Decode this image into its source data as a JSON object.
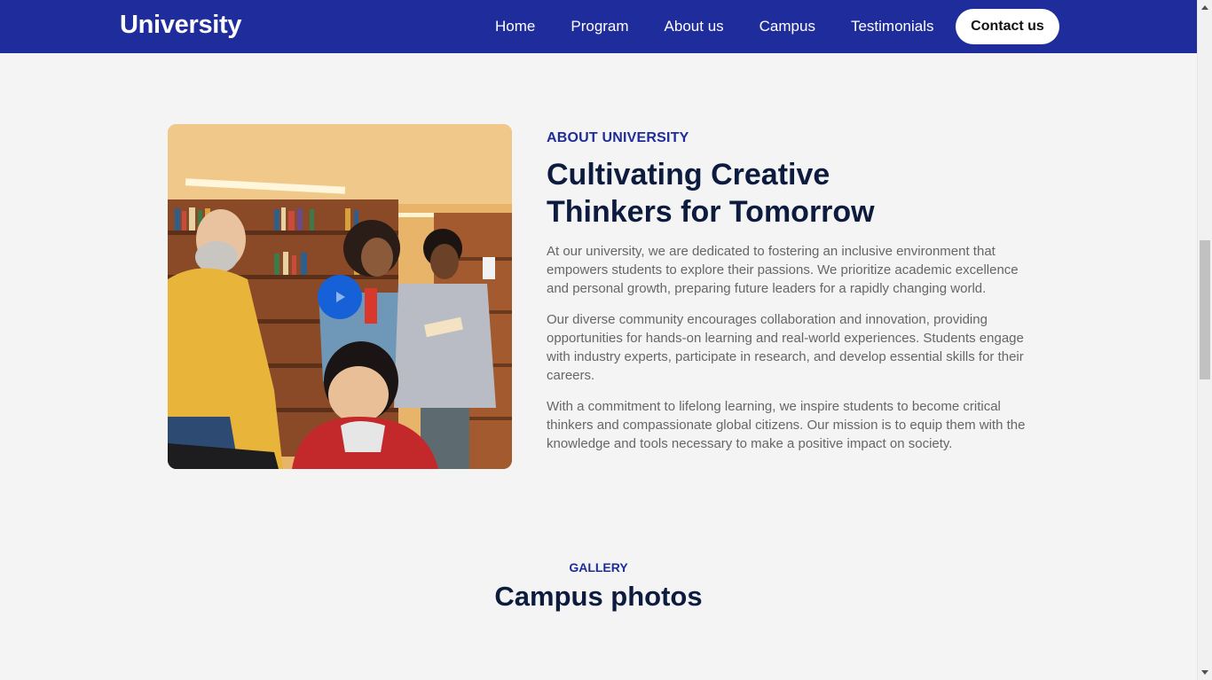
{
  "header": {
    "brand": "University",
    "nav": [
      {
        "label": "Home"
      },
      {
        "label": "Program"
      },
      {
        "label": "About us"
      },
      {
        "label": "Campus"
      },
      {
        "label": "Testimonials"
      }
    ],
    "contact_label": "Contact us"
  },
  "about": {
    "eyebrow": "ABOUT UNIVERSITY",
    "title": "Cultivating Creative Thinkers for Tomorrow",
    "paragraphs": [
      "At our university, we are dedicated to fostering an inclusive environment that empowers students to explore their passions. We prioritize academic excellence and personal growth, preparing future leaders for a rapidly changing world.",
      "Our diverse community encourages collaboration and innovation, providing opportunities for hands-on learning and real-world experiences. Students engage with industry experts, participate in research, and develop essential skills for their careers.",
      "With a commitment to lifelong learning, we inspire students to become critical thinkers and compassionate global citizens. Our mission is to equip them with the knowledge and tools necessary to make a positive impact on society."
    ],
    "media": {
      "icon": "play-icon"
    }
  },
  "gallery": {
    "eyebrow": "GALLERY",
    "title": "Campus photos"
  },
  "colors": {
    "nav_bg": "#1f2c9b",
    "accent": "#1f2c9b",
    "heading": "#0d1b3e",
    "body_text": "#666666",
    "play_button": "#1761d8",
    "page_bg": "#f4f4f4"
  }
}
